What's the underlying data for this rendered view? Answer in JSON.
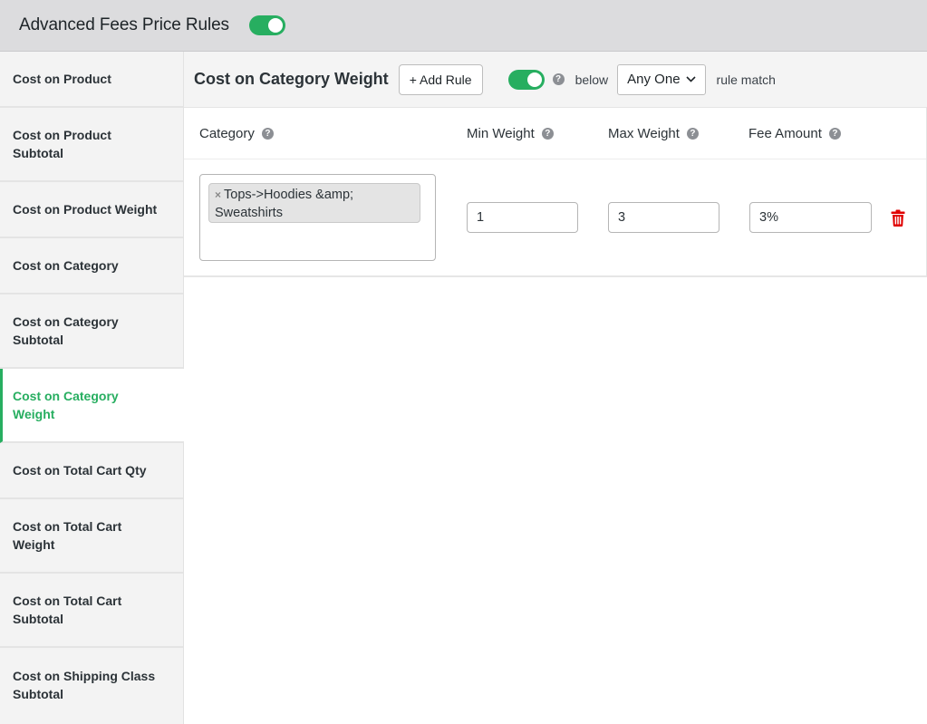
{
  "topbar": {
    "title": "Advanced Fees Price Rules",
    "enabled": true
  },
  "colors": {
    "accent": "#27ae60",
    "toggle_on": "#27ae60",
    "delete": "#e00000",
    "help_icon": "#8c8f94"
  },
  "sidebar": {
    "active_index": 5,
    "items": [
      {
        "label": "Cost on Product"
      },
      {
        "label": "Cost on Product Subtotal"
      },
      {
        "label": "Cost on Product Weight"
      },
      {
        "label": "Cost on Category"
      },
      {
        "label": "Cost on Category Subtotal"
      },
      {
        "label": "Cost on Category Weight"
      },
      {
        "label": "Cost on Total Cart Qty"
      },
      {
        "label": "Cost on Total Cart Weight"
      },
      {
        "label": "Cost on Total Cart Subtotal"
      },
      {
        "label": "Cost on Shipping Class Subtotal"
      }
    ]
  },
  "header": {
    "section_title": "Cost on Category Weight",
    "add_rule_label": "+ Add Rule",
    "rules_enabled": true,
    "help_icon": "?",
    "below_label": "below",
    "match_select": {
      "value": "Any One"
    },
    "rule_match_label": "rule match"
  },
  "table": {
    "columns": [
      {
        "label": "Category",
        "help": "?"
      },
      {
        "label": "Min Weight",
        "help": "?"
      },
      {
        "label": "Max Weight",
        "help": "?"
      },
      {
        "label": "Fee Amount",
        "help": "?"
      }
    ],
    "rows": [
      {
        "categories": [
          {
            "remove": "×",
            "label": "Tops->Hoodies &amp; Sweatshirts"
          }
        ],
        "min_weight": "1",
        "max_weight": "3",
        "fee_amount": "3%"
      }
    ]
  }
}
